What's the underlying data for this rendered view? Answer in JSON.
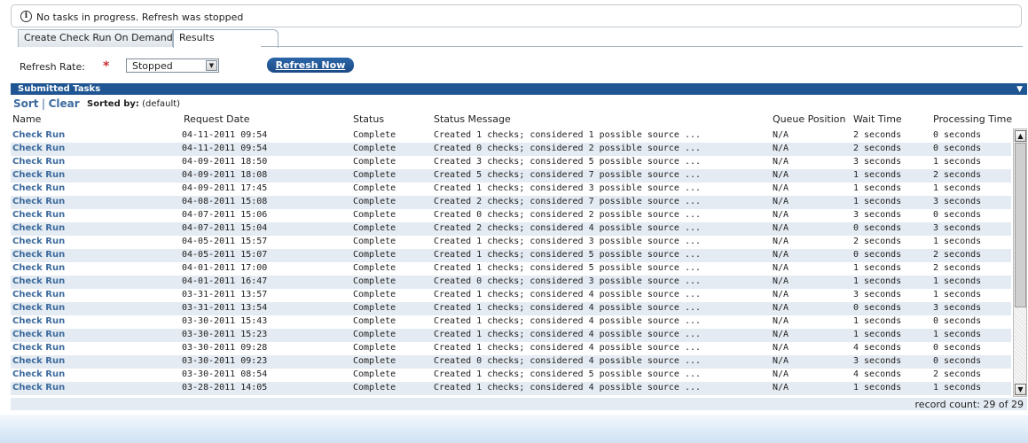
{
  "notice": {
    "icon": "info-icon",
    "text": "No tasks in progress. Refresh was stopped"
  },
  "tabs": [
    {
      "label": "Create Check Run On Demand",
      "active": false
    },
    {
      "label": "Results",
      "active": true
    }
  ],
  "refresh": {
    "label": "Refresh Rate:",
    "required_mark": "*",
    "selected": "Stopped",
    "button_label": "Refresh Now"
  },
  "panel": {
    "title": "Submitted Tasks",
    "sort_label": "Sort",
    "sort_separator": "|",
    "clear_label": "Clear",
    "sorted_by_label": "Sorted by:",
    "sorted_by_value": "(default)"
  },
  "columns": [
    "Name",
    "Request Date",
    "Status",
    "Status Message",
    "Queue Position",
    "Wait Time",
    "Processing Time"
  ],
  "rows": [
    {
      "name": "Check Run",
      "date": "04-11-2011 09:54",
      "status": "Complete",
      "message": "Created 1 checks; considered 1 possible source ...",
      "queue": "N/A",
      "wait": "2 seconds",
      "processing": "0 seconds"
    },
    {
      "name": "Check Run",
      "date": "04-11-2011 09:54",
      "status": "Complete",
      "message": "Created 0 checks; considered 2 possible source ...",
      "queue": "N/A",
      "wait": "2 seconds",
      "processing": "0 seconds"
    },
    {
      "name": "Check Run",
      "date": "04-09-2011 18:50",
      "status": "Complete",
      "message": "Created 3 checks; considered 5 possible source ...",
      "queue": "N/A",
      "wait": "3 seconds",
      "processing": "1 seconds"
    },
    {
      "name": "Check Run",
      "date": "04-09-2011 18:08",
      "status": "Complete",
      "message": "Created 5 checks; considered 7 possible source ...",
      "queue": "N/A",
      "wait": "1 seconds",
      "processing": "2 seconds"
    },
    {
      "name": "Check Run",
      "date": "04-09-2011 17:45",
      "status": "Complete",
      "message": "Created 1 checks; considered 3 possible source ...",
      "queue": "N/A",
      "wait": "1 seconds",
      "processing": "1 seconds"
    },
    {
      "name": "Check Run",
      "date": "04-08-2011 15:08",
      "status": "Complete",
      "message": "Created 2 checks; considered 7 possible source ...",
      "queue": "N/A",
      "wait": "1 seconds",
      "processing": "3 seconds"
    },
    {
      "name": "Check Run",
      "date": "04-07-2011 15:06",
      "status": "Complete",
      "message": "Created 0 checks; considered 2 possible source ...",
      "queue": "N/A",
      "wait": "3 seconds",
      "processing": "0 seconds"
    },
    {
      "name": "Check Run",
      "date": "04-07-2011 15:04",
      "status": "Complete",
      "message": "Created 2 checks; considered 4 possible source ...",
      "queue": "N/A",
      "wait": "0 seconds",
      "processing": "3 seconds"
    },
    {
      "name": "Check Run",
      "date": "04-05-2011 15:57",
      "status": "Complete",
      "message": "Created 1 checks; considered 3 possible source ...",
      "queue": "N/A",
      "wait": "2 seconds",
      "processing": "1 seconds"
    },
    {
      "name": "Check Run",
      "date": "04-05-2011 15:07",
      "status": "Complete",
      "message": "Created 1 checks; considered 5 possible source ...",
      "queue": "N/A",
      "wait": "0 seconds",
      "processing": "2 seconds"
    },
    {
      "name": "Check Run",
      "date": "04-01-2011 17:00",
      "status": "Complete",
      "message": "Created 1 checks; considered 5 possible source ...",
      "queue": "N/A",
      "wait": "1 seconds",
      "processing": "2 seconds"
    },
    {
      "name": "Check Run",
      "date": "04-01-2011 16:47",
      "status": "Complete",
      "message": "Created 0 checks; considered 3 possible source ...",
      "queue": "N/A",
      "wait": "1 seconds",
      "processing": "1 seconds"
    },
    {
      "name": "Check Run",
      "date": "03-31-2011 13:57",
      "status": "Complete",
      "message": "Created 1 checks; considered 4 possible source ...",
      "queue": "N/A",
      "wait": "3 seconds",
      "processing": "1 seconds"
    },
    {
      "name": "Check Run",
      "date": "03-31-2011 13:54",
      "status": "Complete",
      "message": "Created 1 checks; considered 4 possible source ...",
      "queue": "N/A",
      "wait": "0 seconds",
      "processing": "3 seconds"
    },
    {
      "name": "Check Run",
      "date": "03-30-2011 15:43",
      "status": "Complete",
      "message": "Created 1 checks; considered 4 possible source ...",
      "queue": "N/A",
      "wait": "1 seconds",
      "processing": "0 seconds"
    },
    {
      "name": "Check Run",
      "date": "03-30-2011 15:23",
      "status": "Complete",
      "message": "Created 1 checks; considered 4 possible source ...",
      "queue": "N/A",
      "wait": "1 seconds",
      "processing": "1 seconds"
    },
    {
      "name": "Check Run",
      "date": "03-30-2011 09:28",
      "status": "Complete",
      "message": "Created 1 checks; considered 4 possible source ...",
      "queue": "N/A",
      "wait": "4 seconds",
      "processing": "0 seconds"
    },
    {
      "name": "Check Run",
      "date": "03-30-2011 09:23",
      "status": "Complete",
      "message": "Created 0 checks; considered 4 possible source ...",
      "queue": "N/A",
      "wait": "3 seconds",
      "processing": "0 seconds"
    },
    {
      "name": "Check Run",
      "date": "03-30-2011 08:54",
      "status": "Complete",
      "message": "Created 1 checks; considered 5 possible source ...",
      "queue": "N/A",
      "wait": "4 seconds",
      "processing": "2 seconds"
    },
    {
      "name": "Check Run",
      "date": "03-28-2011 14:05",
      "status": "Complete",
      "message": "Created 1 checks; considered 4 possible source ...",
      "queue": "N/A",
      "wait": "1 seconds",
      "processing": "1 seconds"
    }
  ],
  "footer": {
    "record_count": "record count: 29 of 29"
  },
  "colors": {
    "panel_header": "#1f5592",
    "link": "#3d6b9e",
    "alt_row": "#e4ebf2",
    "required": "#c83232"
  }
}
